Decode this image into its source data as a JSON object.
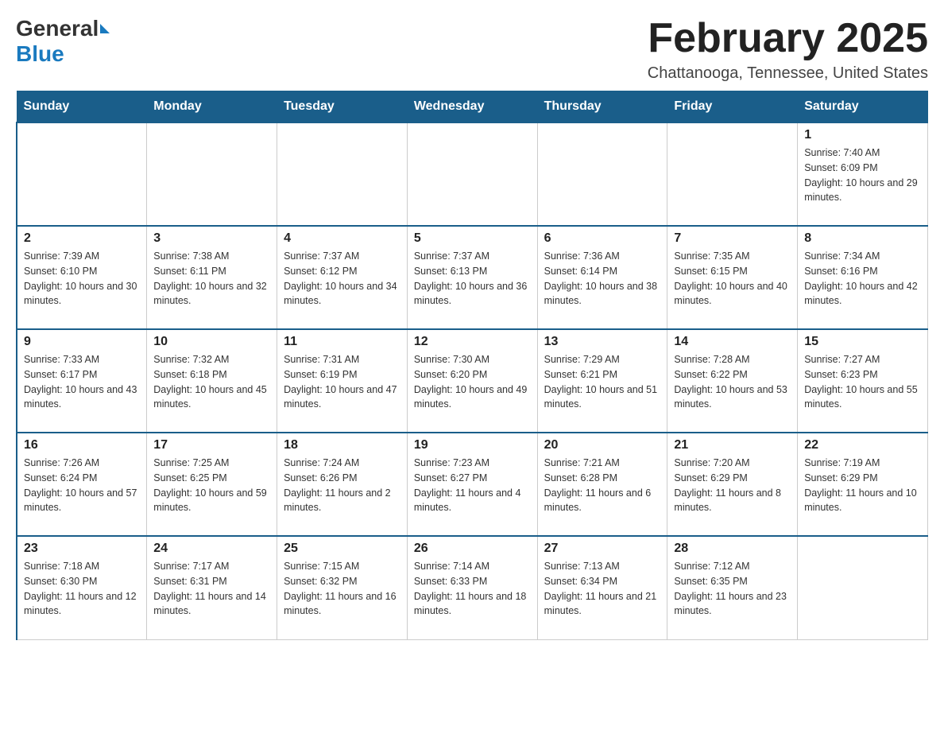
{
  "logo": {
    "text_general": "General",
    "text_blue": "Blue"
  },
  "title": "February 2025",
  "subtitle": "Chattanooga, Tennessee, United States",
  "days_of_week": [
    "Sunday",
    "Monday",
    "Tuesday",
    "Wednesday",
    "Thursday",
    "Friday",
    "Saturday"
  ],
  "weeks": [
    [
      {
        "day": "",
        "sunrise": "",
        "sunset": "",
        "daylight": ""
      },
      {
        "day": "",
        "sunrise": "",
        "sunset": "",
        "daylight": ""
      },
      {
        "day": "",
        "sunrise": "",
        "sunset": "",
        "daylight": ""
      },
      {
        "day": "",
        "sunrise": "",
        "sunset": "",
        "daylight": ""
      },
      {
        "day": "",
        "sunrise": "",
        "sunset": "",
        "daylight": ""
      },
      {
        "day": "",
        "sunrise": "",
        "sunset": "",
        "daylight": ""
      },
      {
        "day": "1",
        "sunrise": "Sunrise: 7:40 AM",
        "sunset": "Sunset: 6:09 PM",
        "daylight": "Daylight: 10 hours and 29 minutes."
      }
    ],
    [
      {
        "day": "2",
        "sunrise": "Sunrise: 7:39 AM",
        "sunset": "Sunset: 6:10 PM",
        "daylight": "Daylight: 10 hours and 30 minutes."
      },
      {
        "day": "3",
        "sunrise": "Sunrise: 7:38 AM",
        "sunset": "Sunset: 6:11 PM",
        "daylight": "Daylight: 10 hours and 32 minutes."
      },
      {
        "day": "4",
        "sunrise": "Sunrise: 7:37 AM",
        "sunset": "Sunset: 6:12 PM",
        "daylight": "Daylight: 10 hours and 34 minutes."
      },
      {
        "day": "5",
        "sunrise": "Sunrise: 7:37 AM",
        "sunset": "Sunset: 6:13 PM",
        "daylight": "Daylight: 10 hours and 36 minutes."
      },
      {
        "day": "6",
        "sunrise": "Sunrise: 7:36 AM",
        "sunset": "Sunset: 6:14 PM",
        "daylight": "Daylight: 10 hours and 38 minutes."
      },
      {
        "day": "7",
        "sunrise": "Sunrise: 7:35 AM",
        "sunset": "Sunset: 6:15 PM",
        "daylight": "Daylight: 10 hours and 40 minutes."
      },
      {
        "day": "8",
        "sunrise": "Sunrise: 7:34 AM",
        "sunset": "Sunset: 6:16 PM",
        "daylight": "Daylight: 10 hours and 42 minutes."
      }
    ],
    [
      {
        "day": "9",
        "sunrise": "Sunrise: 7:33 AM",
        "sunset": "Sunset: 6:17 PM",
        "daylight": "Daylight: 10 hours and 43 minutes."
      },
      {
        "day": "10",
        "sunrise": "Sunrise: 7:32 AM",
        "sunset": "Sunset: 6:18 PM",
        "daylight": "Daylight: 10 hours and 45 minutes."
      },
      {
        "day": "11",
        "sunrise": "Sunrise: 7:31 AM",
        "sunset": "Sunset: 6:19 PM",
        "daylight": "Daylight: 10 hours and 47 minutes."
      },
      {
        "day": "12",
        "sunrise": "Sunrise: 7:30 AM",
        "sunset": "Sunset: 6:20 PM",
        "daylight": "Daylight: 10 hours and 49 minutes."
      },
      {
        "day": "13",
        "sunrise": "Sunrise: 7:29 AM",
        "sunset": "Sunset: 6:21 PM",
        "daylight": "Daylight: 10 hours and 51 minutes."
      },
      {
        "day": "14",
        "sunrise": "Sunrise: 7:28 AM",
        "sunset": "Sunset: 6:22 PM",
        "daylight": "Daylight: 10 hours and 53 minutes."
      },
      {
        "day": "15",
        "sunrise": "Sunrise: 7:27 AM",
        "sunset": "Sunset: 6:23 PM",
        "daylight": "Daylight: 10 hours and 55 minutes."
      }
    ],
    [
      {
        "day": "16",
        "sunrise": "Sunrise: 7:26 AM",
        "sunset": "Sunset: 6:24 PM",
        "daylight": "Daylight: 10 hours and 57 minutes."
      },
      {
        "day": "17",
        "sunrise": "Sunrise: 7:25 AM",
        "sunset": "Sunset: 6:25 PM",
        "daylight": "Daylight: 10 hours and 59 minutes."
      },
      {
        "day": "18",
        "sunrise": "Sunrise: 7:24 AM",
        "sunset": "Sunset: 6:26 PM",
        "daylight": "Daylight: 11 hours and 2 minutes."
      },
      {
        "day": "19",
        "sunrise": "Sunrise: 7:23 AM",
        "sunset": "Sunset: 6:27 PM",
        "daylight": "Daylight: 11 hours and 4 minutes."
      },
      {
        "day": "20",
        "sunrise": "Sunrise: 7:21 AM",
        "sunset": "Sunset: 6:28 PM",
        "daylight": "Daylight: 11 hours and 6 minutes."
      },
      {
        "day": "21",
        "sunrise": "Sunrise: 7:20 AM",
        "sunset": "Sunset: 6:29 PM",
        "daylight": "Daylight: 11 hours and 8 minutes."
      },
      {
        "day": "22",
        "sunrise": "Sunrise: 7:19 AM",
        "sunset": "Sunset: 6:29 PM",
        "daylight": "Daylight: 11 hours and 10 minutes."
      }
    ],
    [
      {
        "day": "23",
        "sunrise": "Sunrise: 7:18 AM",
        "sunset": "Sunset: 6:30 PM",
        "daylight": "Daylight: 11 hours and 12 minutes."
      },
      {
        "day": "24",
        "sunrise": "Sunrise: 7:17 AM",
        "sunset": "Sunset: 6:31 PM",
        "daylight": "Daylight: 11 hours and 14 minutes."
      },
      {
        "day": "25",
        "sunrise": "Sunrise: 7:15 AM",
        "sunset": "Sunset: 6:32 PM",
        "daylight": "Daylight: 11 hours and 16 minutes."
      },
      {
        "day": "26",
        "sunrise": "Sunrise: 7:14 AM",
        "sunset": "Sunset: 6:33 PM",
        "daylight": "Daylight: 11 hours and 18 minutes."
      },
      {
        "day": "27",
        "sunrise": "Sunrise: 7:13 AM",
        "sunset": "Sunset: 6:34 PM",
        "daylight": "Daylight: 11 hours and 21 minutes."
      },
      {
        "day": "28",
        "sunrise": "Sunrise: 7:12 AM",
        "sunset": "Sunset: 6:35 PM",
        "daylight": "Daylight: 11 hours and 23 minutes."
      },
      {
        "day": "",
        "sunrise": "",
        "sunset": "",
        "daylight": ""
      }
    ]
  ]
}
